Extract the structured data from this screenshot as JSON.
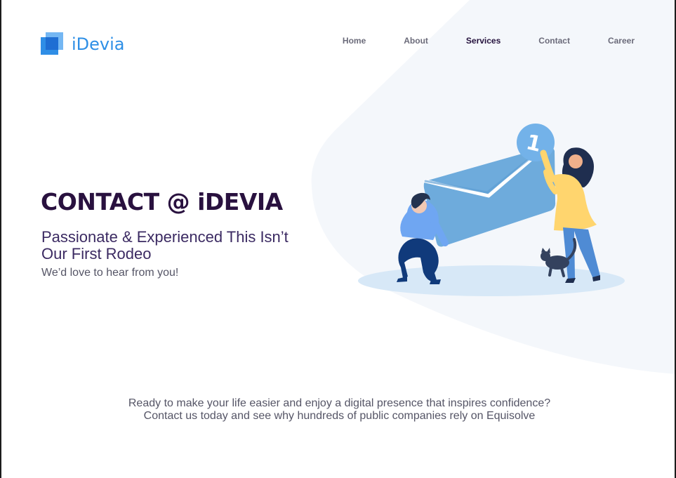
{
  "brand": {
    "name": "iDevia",
    "icon": "stacked-squares-logo-icon",
    "primary_color": "#2e8fe6"
  },
  "navigation": {
    "items": [
      {
        "label": "Home",
        "active": false
      },
      {
        "label": "About",
        "active": false
      },
      {
        "label": "Services",
        "active": true
      },
      {
        "label": "Contact",
        "active": false
      },
      {
        "label": "Career",
        "active": false
      }
    ]
  },
  "hero": {
    "title": "CONTACT @ iDEVIA",
    "subtitle": "Passionate & Experienced This Isn’t Our First Rodeo",
    "note": "We’d love to hear from you!",
    "notification_count": "1"
  },
  "bottom": {
    "line1": "Ready to make your life easier and enjoy a digital presence that inspires confidence?",
    "line2": "Contact us today and see why hundreds of public companies rely on Equisolve"
  },
  "colors": {
    "dark_text": "#29113f",
    "gray_text": "#555566",
    "background_shape": "#f4f7fb"
  }
}
